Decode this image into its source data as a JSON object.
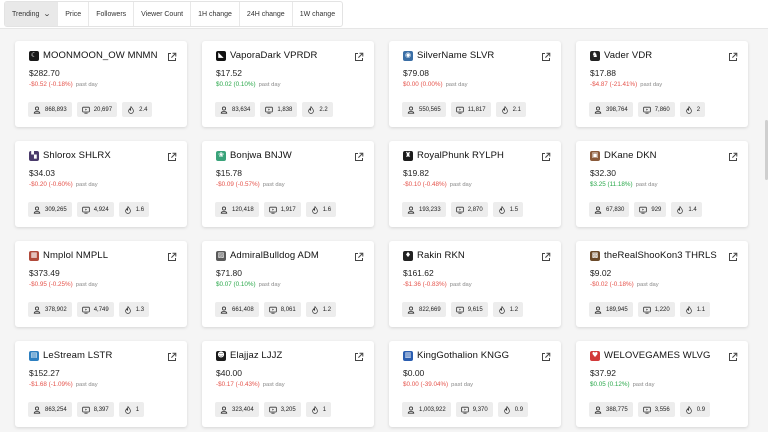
{
  "filters": [
    {
      "label": "Trending",
      "active": true,
      "has_dropdown": true
    },
    {
      "label": "Price"
    },
    {
      "label": "Followers"
    },
    {
      "label": "Viewer Count"
    },
    {
      "label": "1H change"
    },
    {
      "label": "24H change"
    },
    {
      "label": "1W change"
    }
  ],
  "past_day_label": "past day",
  "colors": {
    "negative": "#e5534b",
    "positive": "#2aa84a"
  },
  "cards": [
    {
      "name": "MOONMOON_OW MNMN",
      "logo": {
        "glyph": "☾",
        "bg": "#1a1a1a"
      },
      "price": "$282.70",
      "change": "-$0.52 (-0.18%)",
      "direction": "neg",
      "followers": "868,893",
      "viewers": "20,697",
      "heat": "2.4"
    },
    {
      "name": "VaporaDark VPRDR",
      "logo": {
        "glyph": "◣",
        "bg": "#111111"
      },
      "price": "$17.52",
      "change": "$0.02 (0.10%)",
      "direction": "pos",
      "followers": "83,634",
      "viewers": "1,838",
      "heat": "2.2"
    },
    {
      "name": "SilverName SLVR",
      "logo": {
        "glyph": "◉",
        "bg": "#3a6ea5"
      },
      "price": "$79.08",
      "change": "$0.00 (0.00%)",
      "direction": "neg",
      "followers": "550,565",
      "viewers": "11,817",
      "heat": "2.1"
    },
    {
      "name": "Vader VDR",
      "logo": {
        "glyph": "♞",
        "bg": "#222222"
      },
      "price": "$17.88",
      "change": "-$4.87 (-21.41%)",
      "direction": "neg",
      "followers": "398,764",
      "viewers": "7,860",
      "heat": "2"
    },
    {
      "name": "Shlorox SHLRX",
      "logo": {
        "glyph": "▚",
        "bg": "#4a3b6b"
      },
      "price": "$34.03",
      "change": "-$0.20 (-0.60%)",
      "direction": "neg",
      "followers": "309,265",
      "viewers": "4,924",
      "heat": "1.6"
    },
    {
      "name": "Bonjwa BNJW",
      "logo": {
        "glyph": "❀",
        "bg": "#3aa37a"
      },
      "price": "$15.78",
      "change": "-$0.09 (-0.57%)",
      "direction": "neg",
      "followers": "120,418",
      "viewers": "1,917",
      "heat": "1.6"
    },
    {
      "name": "RoyalPhunk RYLPH",
      "logo": {
        "glyph": "♜",
        "bg": "#1c1c1c"
      },
      "price": "$19.82",
      "change": "-$0.10 (-0.48%)",
      "direction": "neg",
      "followers": "193,233",
      "viewers": "2,870",
      "heat": "1.5"
    },
    {
      "name": "DKane DKN",
      "logo": {
        "glyph": "▣",
        "bg": "#8a5a3a"
      },
      "price": "$32.30",
      "change": "$3.25 (11.18%)",
      "direction": "pos",
      "followers": "67,830",
      "viewers": "929",
      "heat": "1.4"
    },
    {
      "name": "Nmplol NMPLL",
      "logo": {
        "glyph": "▦",
        "bg": "#b04a3a"
      },
      "price": "$373.49",
      "change": "-$0.95 (-0.25%)",
      "direction": "neg",
      "followers": "378,902",
      "viewers": "4,749",
      "heat": "1.3"
    },
    {
      "name": "AdmiralBulldog ADM",
      "logo": {
        "glyph": "▨",
        "bg": "#5a5a5a"
      },
      "price": "$71.80",
      "change": "$0.07 (0.10%)",
      "direction": "pos",
      "followers": "661,408",
      "viewers": "8,061",
      "heat": "1.2"
    },
    {
      "name": "Rakin RKN",
      "logo": {
        "glyph": "♦",
        "bg": "#222222"
      },
      "price": "$161.62",
      "change": "-$1.36 (-0.83%)",
      "direction": "neg",
      "followers": "822,669",
      "viewers": "9,615",
      "heat": "1.2"
    },
    {
      "name": "theRealShooKon3 THRLS",
      "logo": {
        "glyph": "▩",
        "bg": "#6b4a2a"
      },
      "price": "$9.02",
      "change": "-$0.02 (-0.18%)",
      "direction": "neg",
      "followers": "189,945",
      "viewers": "1,220",
      "heat": "1.1"
    },
    {
      "name": "LeStream LSTR",
      "logo": {
        "glyph": "▤",
        "bg": "#2d7fc0"
      },
      "price": "$152.27",
      "change": "-$1.68 (-1.09%)",
      "direction": "neg",
      "followers": "863,254",
      "viewers": "8,397",
      "heat": "1"
    },
    {
      "name": "Elajjaz LJJZ",
      "logo": {
        "glyph": "☻",
        "bg": "#1a1a1a"
      },
      "price": "$40.00",
      "change": "-$0.17 (-0.43%)",
      "direction": "neg",
      "followers": "323,404",
      "viewers": "3,205",
      "heat": "1"
    },
    {
      "name": "KingGothalion KNGG",
      "logo": {
        "glyph": "▥",
        "bg": "#2a5db0"
      },
      "price": "$0.00",
      "change": "$0.00 (-39.04%)",
      "direction": "neg",
      "followers": "1,003,922",
      "viewers": "9,370",
      "heat": "0.9"
    },
    {
      "name": "WELOVEGAMES WLVG",
      "logo": {
        "glyph": "♥",
        "bg": "#d23a3a"
      },
      "price": "$37.92",
      "change": "$0.05 (0.12%)",
      "direction": "pos",
      "followers": "388,775",
      "viewers": "3,556",
      "heat": "0.9"
    }
  ]
}
